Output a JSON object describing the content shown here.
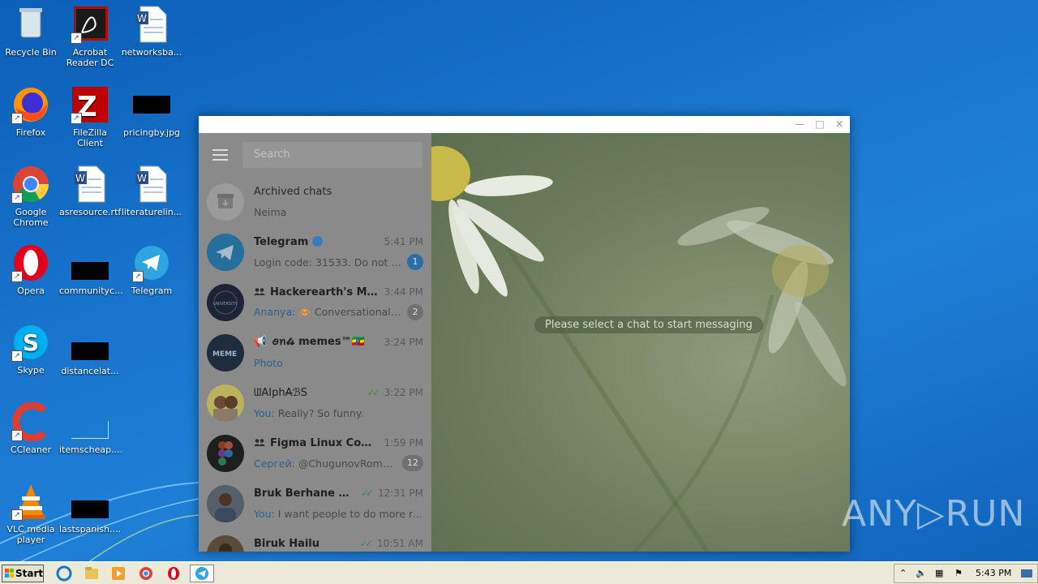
{
  "desktop": {
    "icons": [
      {
        "label": "Recycle Bin",
        "icon": "recycle-bin-icon"
      },
      {
        "label": "Acrobat Reader DC",
        "icon": "acrobat-icon"
      },
      {
        "label": "networksba...",
        "icon": "word-doc-icon"
      },
      {
        "label": "Firefox",
        "icon": "firefox-icon"
      },
      {
        "label": "FileZilla Client",
        "icon": "filezilla-icon"
      },
      {
        "label": "pricingby.jpg",
        "icon": "image-file-icon"
      },
      {
        "label": "Google Chrome",
        "icon": "chrome-icon"
      },
      {
        "label": "asresource.rtf",
        "icon": "word-doc-icon"
      },
      {
        "label": "literaturelin...",
        "icon": "word-doc-icon"
      },
      {
        "label": "Opera",
        "icon": "opera-icon"
      },
      {
        "label": "communityc...",
        "icon": "file-icon"
      },
      {
        "label": "Telegram",
        "icon": "telegram-icon"
      },
      {
        "label": "Skype",
        "icon": "skype-icon"
      },
      {
        "label": "distancelat...",
        "icon": "file-icon"
      },
      {
        "label": "CCleaner",
        "icon": "ccleaner-icon"
      },
      {
        "label": "itemscheap....",
        "icon": "file-icon"
      },
      {
        "label": "VLC media player",
        "icon": "vlc-icon"
      },
      {
        "label": "lastspanish....",
        "icon": "file-icon"
      }
    ]
  },
  "telegram": {
    "search_placeholder": "Search",
    "empty_state": "Please select a chat to start messaging",
    "chats": [
      {
        "name": "Archived chats",
        "preview": "Neima",
        "time": "",
        "badge": ""
      },
      {
        "name": "Telegram",
        "preview": "Login code: 31533. Do not giv...",
        "time": "5:41 PM",
        "badge": "1"
      },
      {
        "name": "Hackerearth's Mac...",
        "sender": "Ananya:",
        "preview": "Conversational a...",
        "time": "3:44 PM",
        "badge": "2"
      },
      {
        "name": "ꪮꪀ𝓽𝓼 memes™🇪🇹",
        "preview": "Photo",
        "time": "3:24 PM",
        "badge": ""
      },
      {
        "name": "ᗯ̈ÃİphÃ̶ℬS",
        "sender": "You:",
        "preview": "Really? So funny.",
        "time": "3:22 PM",
        "badge": ""
      },
      {
        "name": "Figma Linux Comm...",
        "sender": "Сергей:",
        "preview": "@ChugunovRoman ...",
        "time": "1:59 PM",
        "badge": "12"
      },
      {
        "name": "Bruk Berhane Asfaw",
        "sender": "You:",
        "preview": "I want people to do more re...",
        "time": "12:31 PM",
        "badge": ""
      },
      {
        "name": "Biruk Hailu",
        "preview": "",
        "time": "10:51 AM",
        "badge": ""
      }
    ]
  },
  "taskbar": {
    "start_label": "Start",
    "clock": "5:43 PM"
  },
  "watermark": "ANY▷RUN",
  "colors": {
    "desktop_blue": "#1873cc",
    "telegram_blue": "#2a6ea8",
    "sidebar_dimmed": "#8a8a8a"
  }
}
